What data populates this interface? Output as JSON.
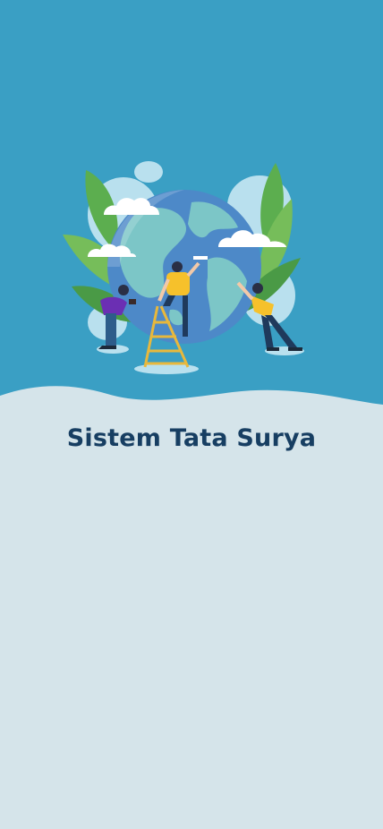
{
  "splash": {
    "title": "Sistem Tata Surya",
    "illustration": "earth-painting-illustration"
  },
  "colors": {
    "header_background": "#3a9fc4",
    "page_background": "#d5e4ea",
    "title_text": "#173e62",
    "globe": "#4d89c8",
    "land": "#7cc6c7",
    "leaves": "#5cae4f"
  }
}
